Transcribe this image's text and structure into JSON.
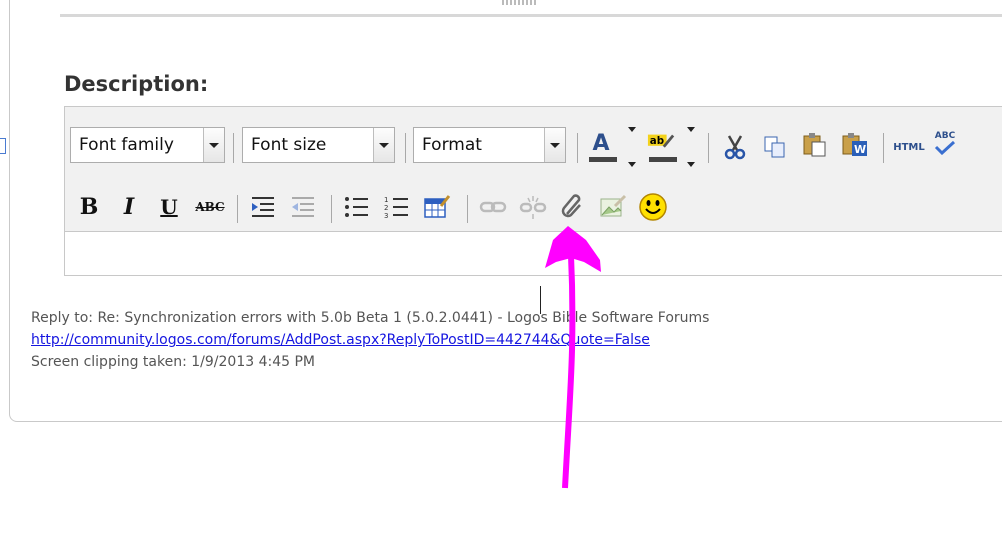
{
  "section": {
    "title": "Description:"
  },
  "toolbar": {
    "font_family": "Font family",
    "font_size": "Font size",
    "format": "Format",
    "html_label": "HTML",
    "spell_label": "ABC",
    "strike_label": "ABC"
  },
  "clipping": {
    "reply_line": "Reply to: Re: Synchronization errors with 5.0b Beta 1 (5.0.2.0441) - Logos Bible Software Forums",
    "url": "http://community.logos.com/forums/AddPost.aspx?ReplyToPostID=442744&Quote=False",
    "taken": "Screen clipping taken: 1/9/2013 4:45 PM"
  },
  "colors": {
    "annotation_arrow": "#ff00ff",
    "link": "#1515e0"
  },
  "icons": [
    "font-color-icon",
    "highlight-color-icon",
    "cut-icon",
    "copy-icon",
    "paste-icon",
    "paste-word-icon",
    "html-icon",
    "spellcheck-icon",
    "bold-icon",
    "italic-icon",
    "underline-icon",
    "strikethrough-icon",
    "indent-icon",
    "outdent-icon",
    "bullet-list-icon",
    "numbered-list-icon",
    "insert-table-icon",
    "link-icon",
    "unlink-icon",
    "attach-icon",
    "insert-image-icon",
    "emoticon-icon"
  ]
}
